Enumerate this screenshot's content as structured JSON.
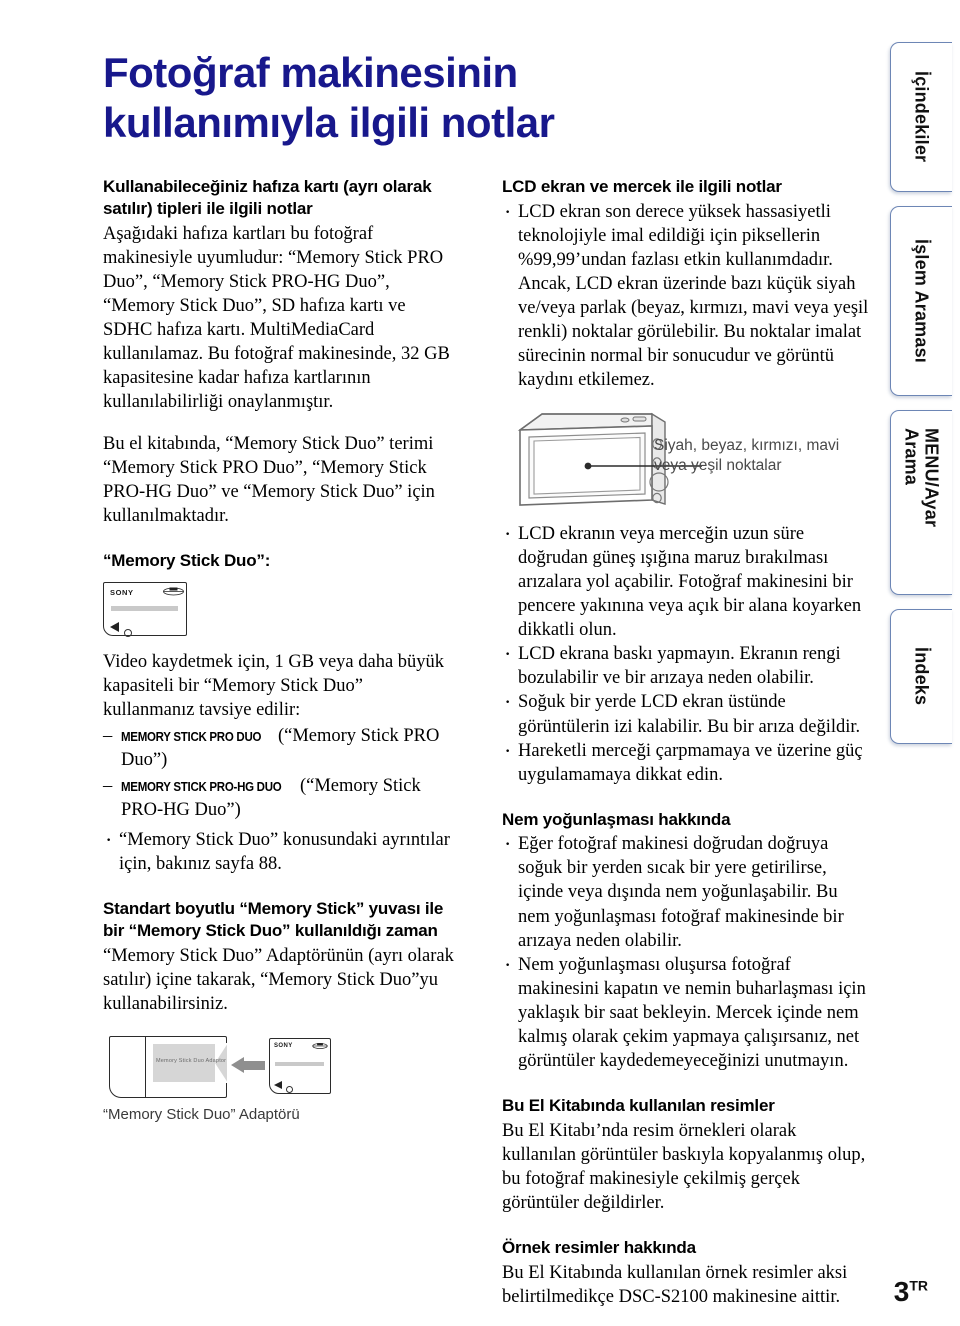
{
  "page": {
    "title": "Fotoğraf makinesinin kullanımıyla ilgili notlar",
    "number": "3",
    "locale_suffix": "TR",
    "title_color": "#18188c",
    "tab_border_color": "#6d86b5"
  },
  "left_column": {
    "heading1": "Kullanabileceğiniz hafıza kartı (ayrı olarak satılır) tipleri ile ilgili notlar",
    "para1": "Aşağıdaki hafıza kartları bu fotoğraf makinesiyle uyumludur: “Memory Stick PRO Duo”, “Memory Stick PRO-HG Duo”, “Memory Stick Duo”, SD hafıza kartı ve SDHC hafıza kartı. MultiMediaCard kullanılamaz. Bu fotoğraf makinesinde, 32 GB kapasitesine kadar hafıza kartlarının kullanılabilirliği onaylanmıştır.",
    "para2": "Bu el kitabında, “Memory Stick Duo” terimi “Memory Stick PRO Duo”, “Memory Stick PRO-HG Duo” ve “Memory Stick Duo” için kullanılmaktadır.",
    "heading2": "“Memory Stick Duo”:",
    "card_figure": {
      "brand": "SONY",
      "name": "memory-stick-duo-card"
    },
    "para3": "Video kaydetmek için, 1 GB veya daha büyük kapasiteli bir “Memory Stick Duo” kullanmanız tavsiye edilir:",
    "dash_items": [
      {
        "logo": "Memory Stick PRO Duo",
        "note": "(“Memory Stick PRO Duo”)"
      },
      {
        "logo": "Memory Stick PRO-HG Duo",
        "note": "(“Memory Stick PRO-HG Duo”)"
      }
    ],
    "bullets1": [
      "“Memory Stick Duo” konusundaki ayrıntılar için, bakınız sayfa 88."
    ],
    "heading3": "Standart boyutlu “Memory Stick” yuvası ile bir “Memory Stick Duo” kullanıldığı zaman",
    "para4": "“Memory Stick Duo” Adaptörünün (ayrı olarak satılır) içine takarak, “Memory Stick Duo”yu kullanabilirsiniz.",
    "adapter_figure": {
      "slot_label": "Memory Stick Duo Adaptor",
      "brand": "SONY",
      "caption": "“Memory Stick Duo” Adaptörü"
    }
  },
  "right_column": {
    "heading1": "LCD ekran ve mercek ile ilgili notlar",
    "bullets1": [
      "LCD ekran son derece yüksek hassasiyetli teknolojiyle imal edildiği için piksellerin %99,99’undan fazlası etkin kullanımdadır. Ancak, LCD ekran üzerinde bazı küçük siyah ve/veya parlak (beyaz, kırmızı, mavi veya yeşil renkli) noktalar görülebilir. Bu noktalar imalat sürecinin normal bir sonucudur ve görüntü kaydını etkilemez."
    ],
    "camera_figure": {
      "callout": "Siyah, beyaz, kırmızı, mavi veya yeşil noktalar",
      "name": "camera-lcd-illustration"
    },
    "bullets2": [
      "LCD ekranın veya merceğin uzun süre doğrudan güneş ışığına maruz bırakılması arızalara yol açabilir. Fotoğraf makinesini bir pencere yakınına veya açık bir alana koyarken dikkatli olun.",
      "LCD ekrana baskı yapmayın. Ekranın rengi bozulabilir ve bir arızaya neden olabilir.",
      "Soğuk bir yerde LCD ekran üstünde görüntülerin izi kalabilir. Bu bir arıza değildir.",
      "Hareketli merceği çarpmamaya ve üzerine güç uygulamamaya dikkat edin."
    ],
    "heading2": "Nem yoğunlaşması hakkında",
    "bullets3": [
      "Eğer fotoğraf makinesi doğrudan doğruya soğuk bir yerden sıcak bir yere getirilirse, içinde veya dışında nem yoğunlaşabilir. Bu nem yoğunlaşması fotoğraf makinesinde bir arızaya neden olabilir.",
      "Nem yoğunlaşması oluşursa fotoğraf makinesini kapatın ve nemin buharlaşması için yaklaşık bir saat bekleyin. Mercek içinde nem kalmış olarak çekim yapmaya çalışırsanız, net görüntüler kaydedemeyeceğinizi unutmayın."
    ],
    "heading3": "Bu El Kitabında kullanılan resimler",
    "para1": "Bu El Kitabı’nda resim örnekleri olarak kullanılan görüntüler baskıyla kopyalanmış olup, bu fotoğraf makinesiyle çekilmiş gerçek görüntüler değildirler.",
    "heading4": "Örnek resimler hakkında",
    "para2": "Bu El Kitabında kullanılan örnek resimler aksi belirtilmedikçe DSC-S2100 makinesine aittir."
  },
  "side_tabs": [
    {
      "label": "İçindekiler",
      "name": "tab-icindekiler"
    },
    {
      "label": "İşlem Araması",
      "name": "tab-islem-aramasi"
    },
    {
      "label": "MENU/Ayar Arama",
      "name": "tab-menu-ayar-arama"
    },
    {
      "label": "İndeks",
      "name": "tab-indeks"
    }
  ]
}
